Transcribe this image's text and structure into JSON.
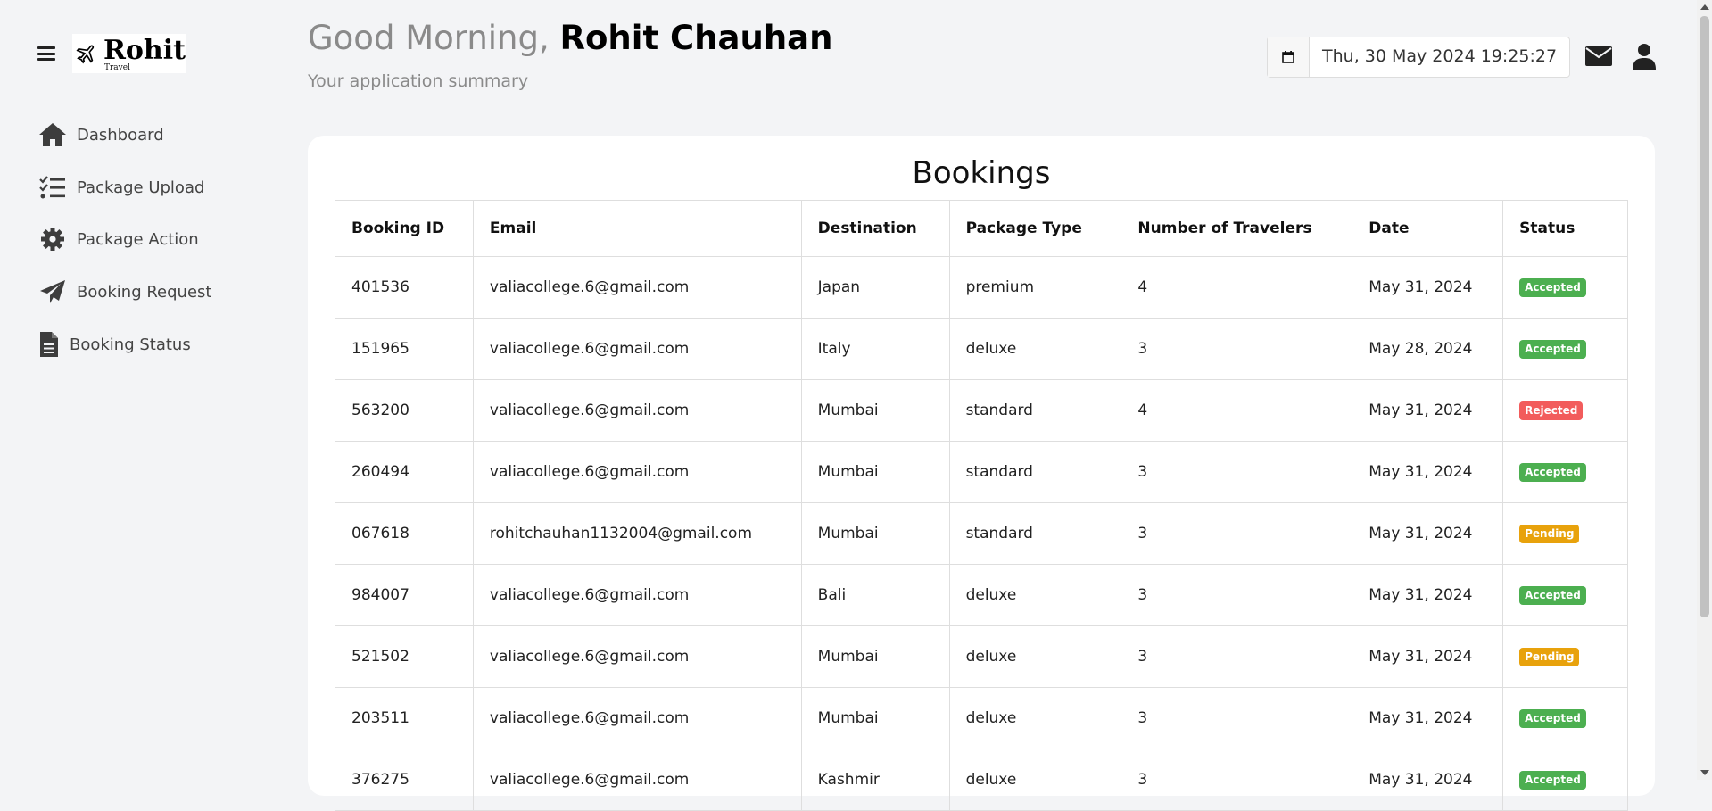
{
  "brand": {
    "name": "Rohit",
    "sub": "Travel"
  },
  "sidebar": {
    "items": [
      {
        "label": "Dashboard",
        "icon": "home-icon"
      },
      {
        "label": "Package Upload",
        "icon": "list-check-icon"
      },
      {
        "label": "Package Action",
        "icon": "gear-icon"
      },
      {
        "label": "Booking Request",
        "icon": "paper-plane-icon"
      },
      {
        "label": "Booking Status",
        "icon": "document-icon"
      }
    ]
  },
  "header": {
    "greeting": "Good Morning,",
    "user_name": "Rohit Chauhan",
    "subtitle": "Your application summary",
    "datetime": "Thu, 30 May 2024 19:25:27"
  },
  "bookings": {
    "title": "Bookings",
    "columns": [
      "Booking ID",
      "Email",
      "Destination",
      "Package Type",
      "Number of Travelers",
      "Date",
      "Status"
    ],
    "rows": [
      {
        "id": "401536",
        "email": "valiacollege.6@gmail.com",
        "destination": "Japan",
        "package": "premium",
        "travelers": "4",
        "date": "May 31, 2024",
        "status": "Accepted"
      },
      {
        "id": "151965",
        "email": "valiacollege.6@gmail.com",
        "destination": "Italy",
        "package": "deluxe",
        "travelers": "3",
        "date": "May 28, 2024",
        "status": "Accepted"
      },
      {
        "id": "563200",
        "email": "valiacollege.6@gmail.com",
        "destination": "Mumbai",
        "package": "standard",
        "travelers": "4",
        "date": "May 31, 2024",
        "status": "Rejected"
      },
      {
        "id": "260494",
        "email": "valiacollege.6@gmail.com",
        "destination": "Mumbai",
        "package": "standard",
        "travelers": "3",
        "date": "May 31, 2024",
        "status": "Accepted"
      },
      {
        "id": "067618",
        "email": "rohitchauhan1132004@gmail.com",
        "destination": "Mumbai",
        "package": "standard",
        "travelers": "3",
        "date": "May 31, 2024",
        "status": "Pending"
      },
      {
        "id": "984007",
        "email": "valiacollege.6@gmail.com",
        "destination": "Bali",
        "package": "deluxe",
        "travelers": "3",
        "date": "May 31, 2024",
        "status": "Accepted"
      },
      {
        "id": "521502",
        "email": "valiacollege.6@gmail.com",
        "destination": "Mumbai",
        "package": "deluxe",
        "travelers": "3",
        "date": "May 31, 2024",
        "status": "Pending"
      },
      {
        "id": "203511",
        "email": "valiacollege.6@gmail.com",
        "destination": "Mumbai",
        "package": "deluxe",
        "travelers": "3",
        "date": "May 31, 2024",
        "status": "Accepted"
      },
      {
        "id": "376275",
        "email": "valiacollege.6@gmail.com",
        "destination": "Kashmir",
        "package": "deluxe",
        "travelers": "3",
        "date": "May 31, 2024",
        "status": "Accepted"
      }
    ]
  },
  "status_colors": {
    "Accepted": "#4caf50",
    "Rejected": "#f25c5c",
    "Pending": "#e8a20c"
  }
}
